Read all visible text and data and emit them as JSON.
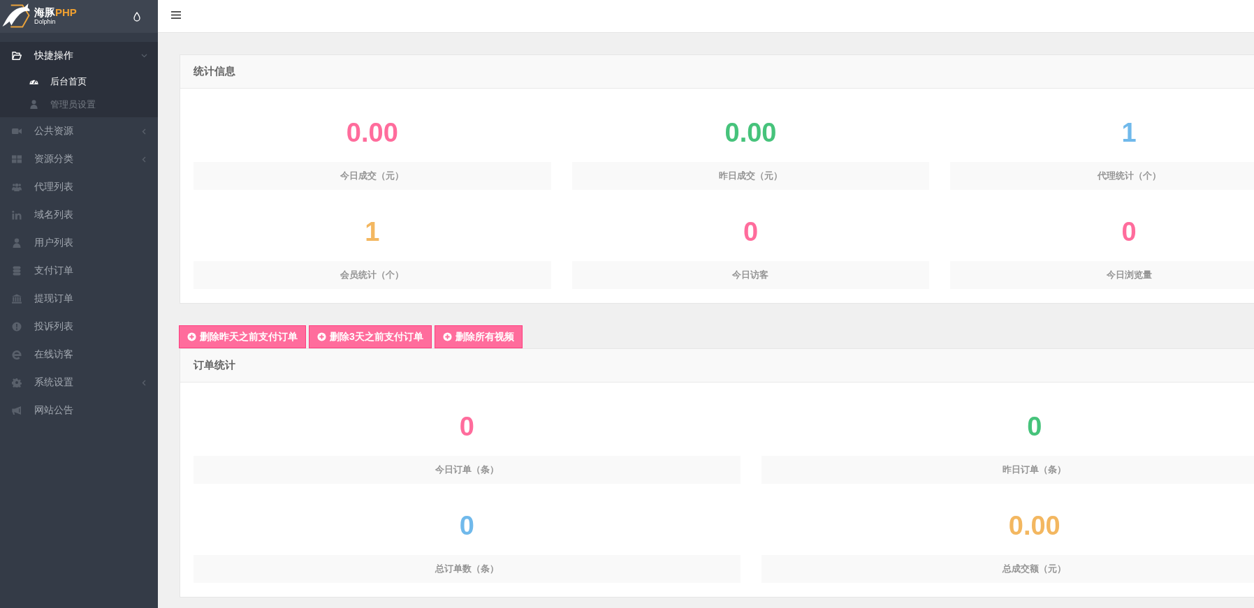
{
  "logo": {
    "name": "海豚",
    "name_accent": "PHP",
    "subtitle": "Dolphin"
  },
  "sidebar": {
    "items": [
      {
        "label": "快捷操作",
        "kind": "group",
        "expanded": true,
        "selected": false,
        "children": [
          {
            "label": "后台首页",
            "selected": true
          },
          {
            "label": "管理员设置",
            "selected": false
          }
        ]
      },
      {
        "label": "公共资源",
        "kind": "group",
        "expanded": false,
        "selected": false
      },
      {
        "label": "资源分类",
        "kind": "group",
        "expanded": false,
        "selected": false
      },
      {
        "label": "代理列表",
        "kind": "link",
        "selected": false
      },
      {
        "label": "域名列表",
        "kind": "link",
        "selected": false
      },
      {
        "label": "用户列表",
        "kind": "link",
        "selected": false
      },
      {
        "label": "支付订单",
        "kind": "link",
        "selected": false
      },
      {
        "label": "提现订单",
        "kind": "link",
        "selected": false
      },
      {
        "label": "投诉列表",
        "kind": "link",
        "selected": false
      },
      {
        "label": "在线访客",
        "kind": "link",
        "selected": false
      },
      {
        "label": "系统设置",
        "kind": "group",
        "expanded": false,
        "selected": false
      },
      {
        "label": "网站公告",
        "kind": "link",
        "selected": false
      }
    ]
  },
  "stats_panel": {
    "title": "统计信息",
    "stats": [
      {
        "value": "0.00",
        "label": "今日成交（元）",
        "color": "#ff6c9c"
      },
      {
        "value": "0.00",
        "label": "昨日成交（元）",
        "color": "#46c37b"
      },
      {
        "value": "1",
        "label": "代理统计（个）",
        "color": "#70b9eb"
      },
      {
        "value": "1",
        "label": "会员统计（个）",
        "color": "#f3b760"
      },
      {
        "value": "0",
        "label": "今日访客",
        "color": "#ff6c9c"
      },
      {
        "value": "0",
        "label": "今日浏览量",
        "color": "#ff6c9c"
      }
    ]
  },
  "actions": [
    {
      "label": "删除昨天之前支付订单"
    },
    {
      "label": "删除3天之前支付订单"
    },
    {
      "label": "删除所有视频"
    }
  ],
  "orders_panel": {
    "title": "订单统计",
    "stats": [
      {
        "value": "0",
        "label": "今日订单（条）",
        "color": "#ff6c9c"
      },
      {
        "value": "0",
        "label": "昨日订单（条）",
        "color": "#46c37b"
      },
      {
        "value": "0",
        "label": "总订单数（条）",
        "color": "#70b9eb"
      },
      {
        "value": "0.00",
        "label": "总成交额（元）",
        "color": "#f3b760"
      }
    ]
  }
}
